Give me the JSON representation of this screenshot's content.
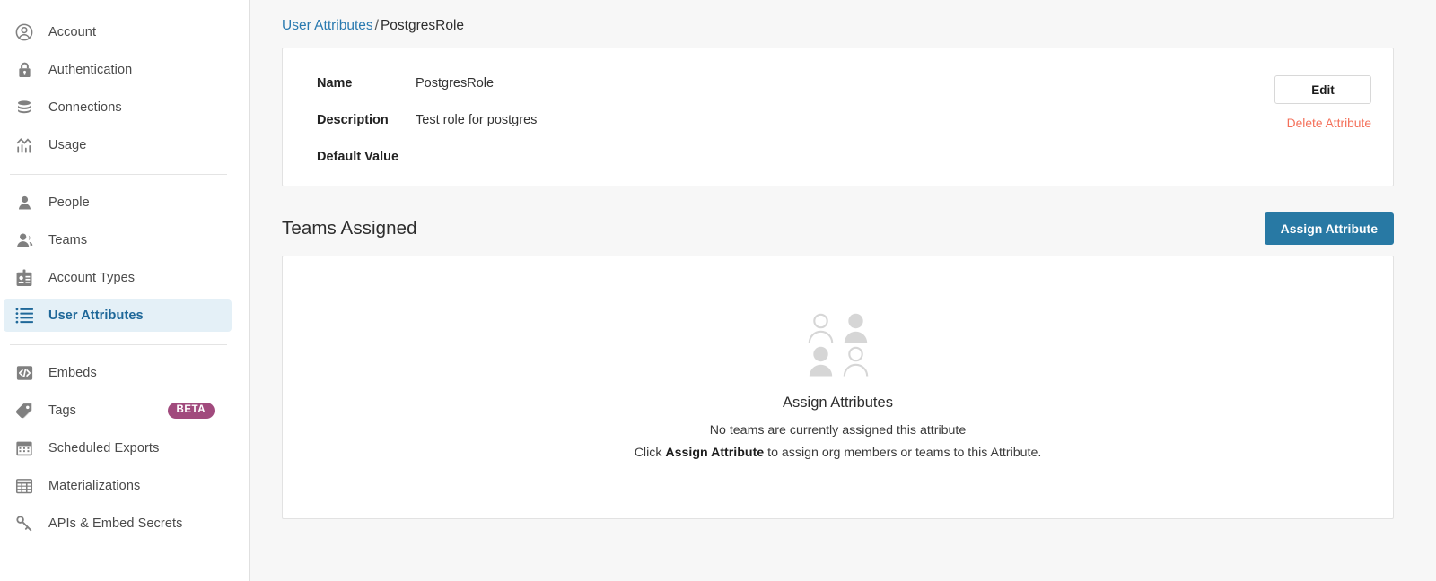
{
  "sidebar": {
    "groups": [
      {
        "items": [
          {
            "label": "Account",
            "icon": "account-circle-icon",
            "selected": false
          },
          {
            "label": "Authentication",
            "icon": "lock-icon",
            "selected": false
          },
          {
            "label": "Connections",
            "icon": "database-icon",
            "selected": false
          },
          {
            "label": "Usage",
            "icon": "chart-usage-icon",
            "selected": false
          }
        ]
      },
      {
        "items": [
          {
            "label": "People",
            "icon": "person-icon",
            "selected": false
          },
          {
            "label": "Teams",
            "icon": "people-icon",
            "selected": false
          },
          {
            "label": "Account Types",
            "icon": "id-badge-icon",
            "selected": false
          },
          {
            "label": "User Attributes",
            "icon": "list-icon",
            "selected": true
          }
        ]
      },
      {
        "items": [
          {
            "label": "Embeds",
            "icon": "code-brackets-icon",
            "selected": false
          },
          {
            "label": "Tags",
            "icon": "tag-icon",
            "selected": false,
            "badge": "BETA"
          },
          {
            "label": "Scheduled Exports",
            "icon": "calendar-icon",
            "selected": false
          },
          {
            "label": "Materializations",
            "icon": "table-grid-icon",
            "selected": false
          },
          {
            "label": "APIs & Embed Secrets",
            "icon": "key-icon",
            "selected": false
          }
        ]
      }
    ]
  },
  "breadcrumb": {
    "parent": "User Attributes",
    "separator": "/",
    "current": "PostgresRole"
  },
  "detail": {
    "rows": [
      {
        "label": "Name",
        "value": "PostgresRole"
      },
      {
        "label": "Description",
        "value": "Test role for postgres"
      },
      {
        "label": "Default Value",
        "value": ""
      }
    ],
    "edit_label": "Edit",
    "delete_label": "Delete Attribute"
  },
  "teams_section": {
    "title": "Teams Assigned",
    "assign_label": "Assign Attribute",
    "empty_state": {
      "illustration": "people-grid-illustration",
      "title": "Assign Attributes",
      "line1": "No teams are currently assigned this attribute",
      "line2_prefix": "Click ",
      "line2_bold": "Assign Attribute",
      "line2_suffix": " to assign org members or teams to this Attribute."
    }
  },
  "colors": {
    "accent_blue": "#2879a4",
    "link_blue": "#2a7ab0",
    "selected_bg": "#e4f0f7",
    "danger": "#f4705a",
    "beta_badge": "#a14a7d",
    "page_bg": "#f7f7f7"
  }
}
